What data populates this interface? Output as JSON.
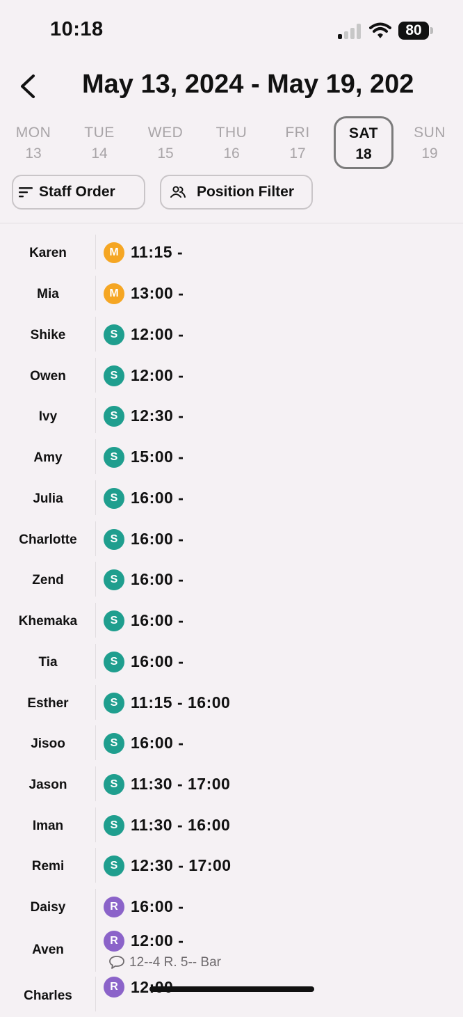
{
  "status": {
    "time": "10:18",
    "battery": "80"
  },
  "header": {
    "title": "May 13, 2024 - May 19, 202"
  },
  "days": [
    {
      "name": "MON",
      "num": "13"
    },
    {
      "name": "TUE",
      "num": "14"
    },
    {
      "name": "WED",
      "num": "15"
    },
    {
      "name": "THU",
      "num": "16"
    },
    {
      "name": "FRI",
      "num": "17"
    },
    {
      "name": "SAT",
      "num": "18",
      "active": true
    },
    {
      "name": "SUN",
      "num": "19"
    }
  ],
  "filters": {
    "staff_order": "Staff Order",
    "position_filter": "Position Filter"
  },
  "colors": {
    "M": "#f5a623",
    "S": "#1f9e8e",
    "R": "#8b63c9"
  },
  "staff": [
    {
      "name": "Karen",
      "role": "M",
      "shift": "11:15 -"
    },
    {
      "name": "Mia",
      "role": "M",
      "shift": "13:00 -"
    },
    {
      "name": "Shike",
      "role": "S",
      "shift": "12:00 -"
    },
    {
      "name": "Owen",
      "role": "S",
      "shift": "12:00 -"
    },
    {
      "name": "Ivy",
      "role": "S",
      "shift": "12:30 -"
    },
    {
      "name": "Amy",
      "role": "S",
      "shift": "15:00 -"
    },
    {
      "name": "Julia",
      "role": "S",
      "shift": "16:00 -"
    },
    {
      "name": "Charlotte",
      "role": "S",
      "shift": "16:00 -"
    },
    {
      "name": "Zend",
      "role": "S",
      "shift": "16:00 -"
    },
    {
      "name": "Khemaka",
      "role": "S",
      "shift": "16:00 -"
    },
    {
      "name": "Tia",
      "role": "S",
      "shift": "16:00 -"
    },
    {
      "name": "Esther",
      "role": "S",
      "shift": "11:15 - 16:00"
    },
    {
      "name": "Jisoo",
      "role": "S",
      "shift": "16:00 -"
    },
    {
      "name": "Jason",
      "role": "S",
      "shift": "11:30 - 17:00"
    },
    {
      "name": "Iman",
      "role": "S",
      "shift": "11:30 - 16:00"
    },
    {
      "name": "Remi",
      "role": "S",
      "shift": "12:30 - 17:00"
    },
    {
      "name": "Daisy",
      "role": "R",
      "shift": "16:00 -"
    },
    {
      "name": "Aven",
      "role": "R",
      "shift": "12:00 -",
      "note": "12--4 R. 5-- Bar"
    },
    {
      "name": "Charles",
      "role": "R",
      "shift": "12:00"
    }
  ]
}
